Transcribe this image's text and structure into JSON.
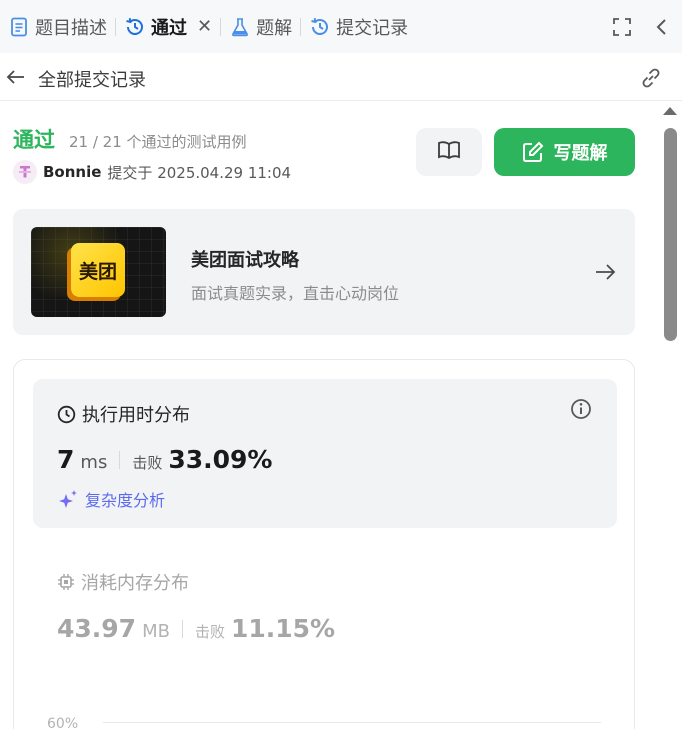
{
  "tabs": [
    {
      "label": "题目描述",
      "icon": "description-icon",
      "active": false
    },
    {
      "label": "通过",
      "icon": "history-icon",
      "active": true,
      "closable": true
    },
    {
      "label": "题解",
      "icon": "flask-icon",
      "active": false
    },
    {
      "label": "提交记录",
      "icon": "history-icon",
      "active": false
    }
  ],
  "tab_close_glyph": "✕",
  "subheader": {
    "title": "全部提交记录"
  },
  "result": {
    "status": "通过",
    "detail": "21 / 21 个通过的测试用例",
    "author": "Bonnie",
    "submitted": "提交于 2025.04.29 11:04"
  },
  "actions": {
    "write_solution": "写题解"
  },
  "promo": {
    "logo_text": "美团",
    "title": "美团面试攻略",
    "subtitle": "面试真题实录，直击心动岗位"
  },
  "runtime": {
    "title": "执行用时分布",
    "value": "7",
    "unit": "ms",
    "beat_label": "击败",
    "beat_value": "33.09%",
    "complexity_link": "复杂度分析"
  },
  "memory": {
    "title": "消耗内存分布",
    "value": "43.97",
    "unit": "MB",
    "beat_label": "击败",
    "beat_value": "11.15%"
  },
  "chart": {
    "y_tick_top": "60%"
  },
  "colors": {
    "accent_green": "#2db55d",
    "ai_purple": "#5b6bf0",
    "panel_bg": "#f2f3f5"
  }
}
